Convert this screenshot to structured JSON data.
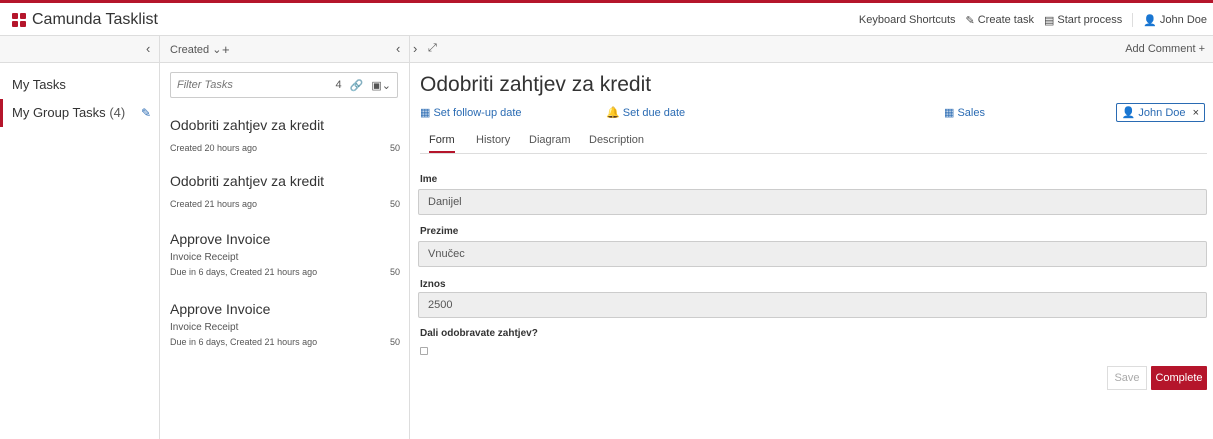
{
  "app": {
    "title": "Camunda Tasklist"
  },
  "topnav": {
    "keyboard_shortcuts": "Keyboard Shortcuts",
    "create_task": "Create task",
    "start_process": "Start process",
    "user": "John Doe"
  },
  "toolbar": {
    "sort_label": "Created",
    "add_comment": "Add Comment"
  },
  "sidebar": {
    "items": [
      {
        "label": "My Tasks",
        "count": ""
      },
      {
        "label": "My Group Tasks",
        "count": "(4)"
      }
    ]
  },
  "filter": {
    "placeholder": "Filter Tasks",
    "count": "4"
  },
  "tasks": [
    {
      "name": "Odobriti zahtjev za kredit",
      "process": "",
      "meta": "Created 20 hours ago",
      "priority": "50"
    },
    {
      "name": "Odobriti zahtjev za kredit",
      "process": "",
      "meta": "Created 21 hours ago",
      "priority": "50"
    },
    {
      "name": "Approve Invoice",
      "process": "Invoice Receipt",
      "meta": "Due in 6 days, Created 21 hours ago",
      "priority": "50"
    },
    {
      "name": "Approve Invoice",
      "process": "Invoice Receipt",
      "meta": "Due in 6 days, Created 21 hours ago",
      "priority": "50"
    }
  ],
  "detail": {
    "title": "Odobriti zahtjev za kredit",
    "follow_up": "Set follow-up date",
    "due_date": "Set due date",
    "group": "Sales",
    "assignee": "John Doe",
    "tabs": [
      "Form",
      "History",
      "Diagram",
      "Description"
    ],
    "fields": [
      {
        "label": "Ime",
        "value": "Danijel"
      },
      {
        "label": "Prezime",
        "value": "Vnučec"
      },
      {
        "label": "Iznos",
        "value": "2500"
      }
    ],
    "checkbox_label": "Dali odobravate zahtjev?",
    "save_label": "Save",
    "complete_label": "Complete"
  },
  "colors": {
    "accent": "#b5152b",
    "link": "#2a6bb3"
  }
}
